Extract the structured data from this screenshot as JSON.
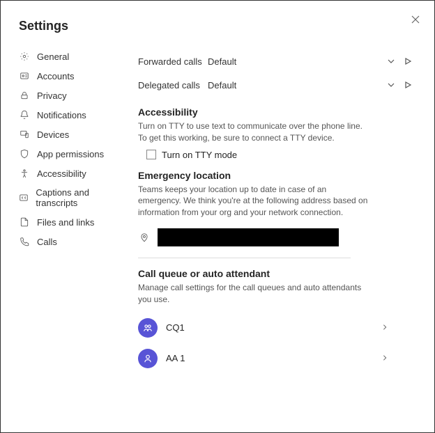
{
  "title": "Settings",
  "sidebar": {
    "items": [
      {
        "label": "General"
      },
      {
        "label": "Accounts"
      },
      {
        "label": "Privacy"
      },
      {
        "label": "Notifications"
      },
      {
        "label": "Devices"
      },
      {
        "label": "App permissions"
      },
      {
        "label": "Accessibility"
      },
      {
        "label": "Captions and transcripts"
      },
      {
        "label": "Files and links"
      },
      {
        "label": "Calls"
      }
    ]
  },
  "calls": {
    "forwarded_label": "Forwarded calls",
    "forwarded_value": "Default",
    "delegated_label": "Delegated calls",
    "delegated_value": "Default"
  },
  "accessibility": {
    "heading": "Accessibility",
    "desc": "Turn on TTY to use text to communicate over the phone line. To get this working, be sure to connect a TTY device.",
    "checkbox_label": "Turn on TTY mode"
  },
  "emergency": {
    "heading": "Emergency location",
    "desc": "Teams keeps your location up to date in case of an emergency. We think you're at the following address based on information from your org and your network connection."
  },
  "cqaa": {
    "heading": "Call queue or auto attendant",
    "desc": "Manage call settings for the call queues and auto attendants you use.",
    "items": [
      {
        "label": "CQ1"
      },
      {
        "label": "AA 1"
      }
    ]
  }
}
